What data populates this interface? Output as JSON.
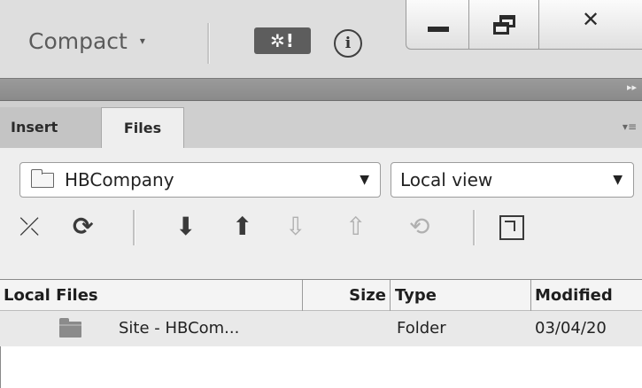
{
  "window": {
    "workspace_label": "Compact",
    "caret_icon": "▾",
    "gear_label": "✲!",
    "info_label": "i",
    "close_label": "✕"
  },
  "panel_header": {
    "collapse_glyph": "▸▸"
  },
  "tabs": [
    {
      "label": "Insert",
      "active": false
    },
    {
      "label": "Files",
      "active": true
    }
  ],
  "tab_menu_glyph": "▾≡",
  "files_panel": {
    "site_select": {
      "value": "HBCompany"
    },
    "view_select": {
      "value": "Local view"
    },
    "dropdown_glyph": "▼",
    "toolbar": [
      {
        "name": "connect-icon",
        "glyph": "⤫",
        "enabled": true
      },
      {
        "name": "refresh-icon",
        "glyph": "⟳",
        "enabled": true
      },
      {
        "name": "get-files-icon",
        "glyph": "⬇",
        "enabled": true
      },
      {
        "name": "put-files-icon",
        "glyph": "⬆",
        "enabled": true
      },
      {
        "name": "check-out-icon",
        "glyph": "⇩",
        "enabled": false
      },
      {
        "name": "check-in-icon",
        "glyph": "⇧",
        "enabled": false
      },
      {
        "name": "synchronize-icon",
        "glyph": "⟲",
        "enabled": false
      },
      {
        "name": "expand-icon",
        "glyph": "",
        "enabled": true
      }
    ]
  },
  "file_list": {
    "columns": [
      "Local Files",
      "Size",
      "Type",
      "Modified"
    ],
    "rows": [
      {
        "name": "Site - HBCom...",
        "size": "",
        "type": "Folder",
        "modified": "03/04/20"
      }
    ]
  }
}
